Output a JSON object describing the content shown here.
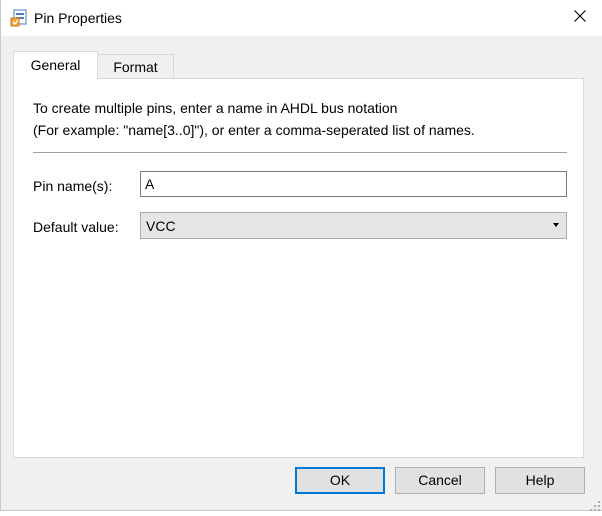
{
  "window": {
    "title": "Pin Properties",
    "icon": "pin-properties-app-icon",
    "close_icon": "close-icon"
  },
  "tabs": [
    {
      "label": "General",
      "active": true
    },
    {
      "label": "Format",
      "active": false
    }
  ],
  "general": {
    "description_line1": "To create multiple pins, enter a name in AHDL bus notation",
    "description_line2": "(For example: \"name[3..0]\"), or enter a comma-seperated list of names.",
    "pin_name_label": "Pin name(s):",
    "pin_name_value": "A",
    "default_value_label": "Default value:",
    "default_value_selected": "VCC"
  },
  "buttons": {
    "ok": "OK",
    "cancel": "Cancel",
    "help": "Help"
  },
  "colors": {
    "accent": "#0078d7",
    "dialog_bg": "#f0f0f0",
    "panel_bg": "#ffffff"
  }
}
